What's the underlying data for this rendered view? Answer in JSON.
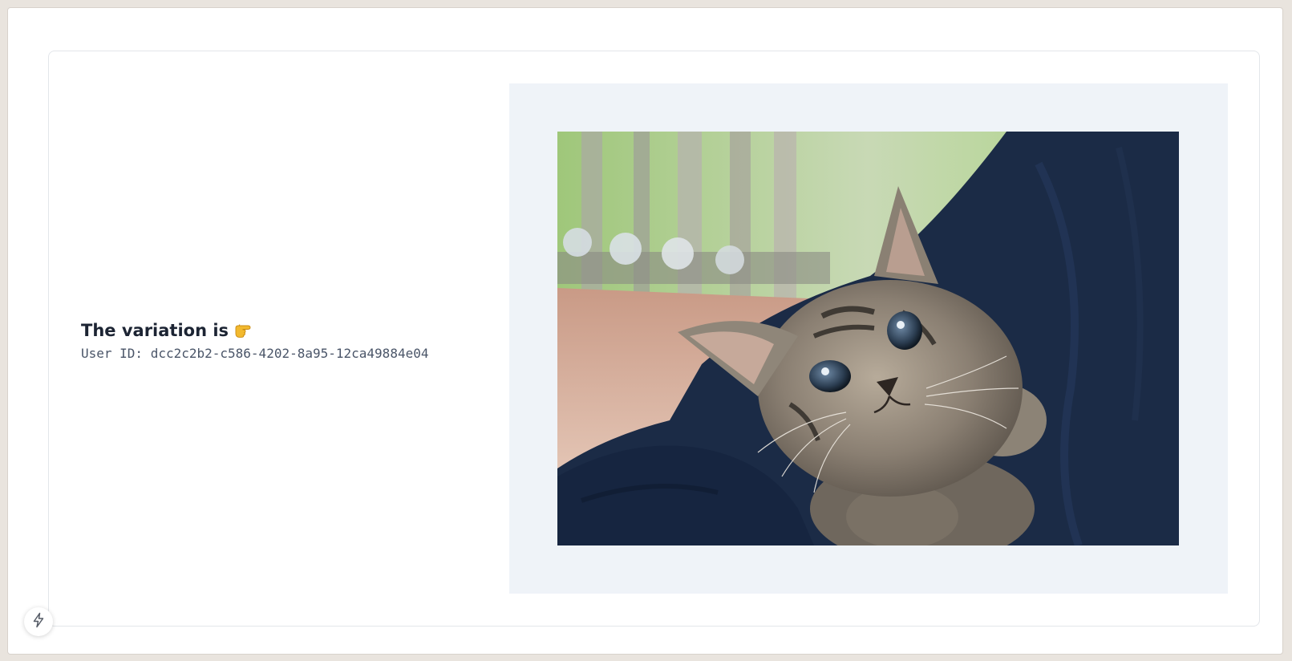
{
  "heading": {
    "text": "The variation is",
    "emoji_icon": "backhand-index-pointing-right"
  },
  "user_id": {
    "text": "User ID: dcc2c2b2-c586-4202-8a95-12ca49884e04"
  },
  "image": {
    "alt": "kitten"
  },
  "floating_button": {
    "icon": "lightning-bolt-icon"
  },
  "colors": {
    "panel_background": "#eff3f8",
    "heading_text": "#1c2433",
    "mono_text": "#4a5568"
  }
}
